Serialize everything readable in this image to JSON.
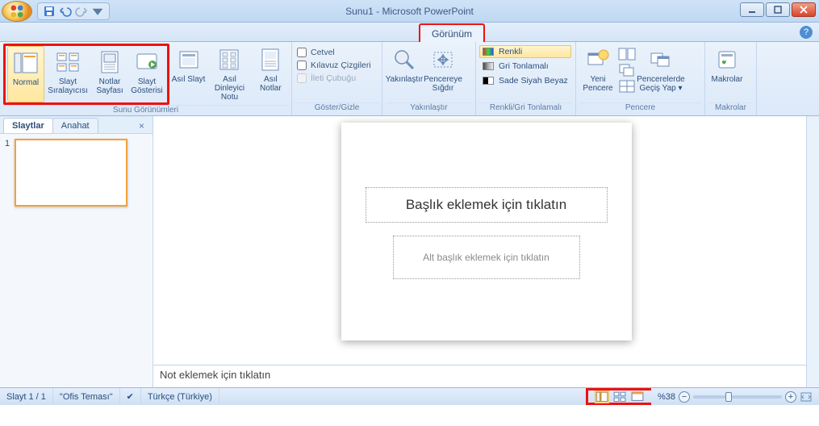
{
  "title": "Sunu1 - Microsoft PowerPoint",
  "tab_active": "Görünüm",
  "ribbon": {
    "g1": {
      "label": "Sunu Görünümleri",
      "normal": "Normal",
      "sorter": "Slayt Sıralayıcısı",
      "notes": "Notlar Sayfası",
      "show": "Slayt Gösterisi",
      "master_slide": "Asıl Slayt",
      "master_handout": "Asıl Dinleyici Notu",
      "master_notes": "Asıl Notlar"
    },
    "g2": {
      "label": "Göster/Gizle",
      "ruler": "Cetvel",
      "grid": "Kılavuz Çizgileri",
      "msgbar": "İleti Çubuğu"
    },
    "g3": {
      "label": "Yakınlaştır",
      "zoom": "Yakınlaştır",
      "fit": "Pencereye Sığdır"
    },
    "g4": {
      "label": "Renkli/Gri Tonlamalı",
      "color": "Renkli",
      "gray": "Gri Tonlamalı",
      "bw": "Sade Siyah Beyaz"
    },
    "g5": {
      "label": "Pencere",
      "new": "Yeni Pencere",
      "switch": "Pencerelerde Geçiş Yap"
    },
    "g6": {
      "label": "Makrolar",
      "macros": "Makrolar"
    }
  },
  "panel": {
    "tab_slides": "Slaytlar",
    "tab_outline": "Anahat",
    "slide_num": "1"
  },
  "slide": {
    "title_ph": "Başlık eklemek için tıklatın",
    "sub_ph": "Alt başlık eklemek için tıklatın"
  },
  "notes_ph": "Not eklemek için tıklatın",
  "status": {
    "slide": "Slayt 1 / 1",
    "theme": "\"Ofis Teması\"",
    "lang": "Türkçe (Türkiye)",
    "zoom": "%38"
  }
}
